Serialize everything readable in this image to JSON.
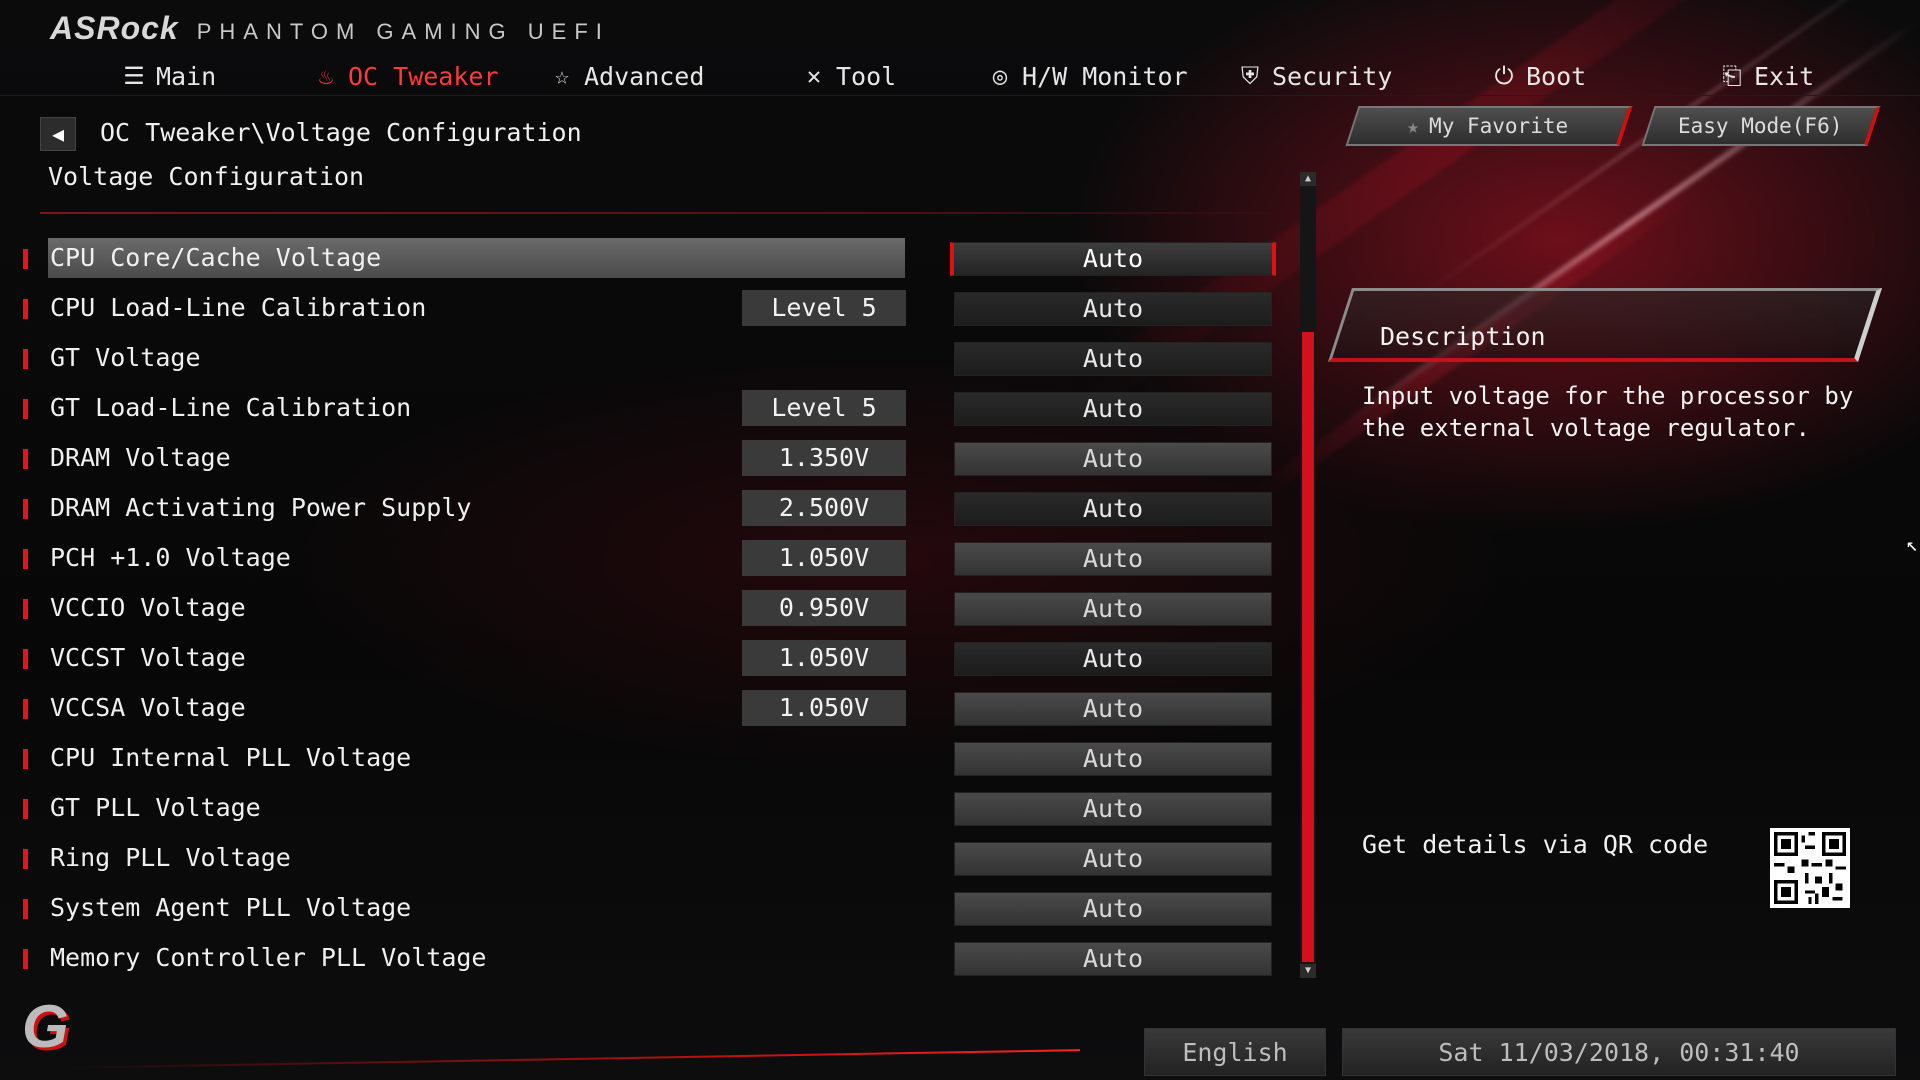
{
  "brand": {
    "logo": "ASRock",
    "subtitle": "PHANTOM GAMING UEFI"
  },
  "nav": [
    {
      "label": "Main",
      "icon": "list-icon",
      "glyph": "☰"
    },
    {
      "label": "OC Tweaker",
      "icon": "flame-icon",
      "glyph": "♨"
    },
    {
      "label": "Advanced",
      "icon": "star-icon",
      "glyph": "☆"
    },
    {
      "label": "Tool",
      "icon": "tools-icon",
      "glyph": "✕"
    },
    {
      "label": "H/W Monitor",
      "icon": "monitor-icon",
      "glyph": "◎"
    },
    {
      "label": "Security",
      "icon": "shield-icon",
      "glyph": "⛨"
    },
    {
      "label": "Boot",
      "icon": "power-icon",
      "glyph": "⏻"
    },
    {
      "label": "Exit",
      "icon": "exit-icon",
      "glyph": "⎗"
    }
  ],
  "active_tab": "OC Tweaker",
  "breadcrumb": "OC Tweaker\\Voltage Configuration",
  "page_title": "Voltage Configuration",
  "settings": [
    {
      "label": "CPU Core/Cache Voltage",
      "current": "",
      "value": "Auto",
      "selected": true
    },
    {
      "label": "CPU Load-Line Calibration",
      "current": "Level 5",
      "value": "Auto"
    },
    {
      "label": "GT Voltage",
      "current": "",
      "value": "Auto"
    },
    {
      "label": "GT Load-Line Calibration",
      "current": "Level 5",
      "value": "Auto"
    },
    {
      "label": "DRAM Voltage",
      "current": "1.350V",
      "value": "Auto"
    },
    {
      "label": "DRAM Activating Power Supply",
      "current": "2.500V",
      "value": "Auto"
    },
    {
      "label": "PCH +1.0 Voltage",
      "current": "1.050V",
      "value": "Auto"
    },
    {
      "label": "VCCIO Voltage",
      "current": "0.950V",
      "value": "Auto"
    },
    {
      "label": "VCCST Voltage",
      "current": "1.050V",
      "value": "Auto"
    },
    {
      "label": "VCCSA Voltage",
      "current": "1.050V",
      "value": "Auto"
    },
    {
      "label": "CPU Internal PLL Voltage",
      "current": "",
      "value": "Auto"
    },
    {
      "label": "GT PLL Voltage",
      "current": "",
      "value": "Auto"
    },
    {
      "label": "Ring PLL Voltage",
      "current": "",
      "value": "Auto"
    },
    {
      "label": "System Agent PLL Voltage",
      "current": "",
      "value": "Auto"
    },
    {
      "label": "Memory Controller PLL Voltage",
      "current": "",
      "value": "Auto"
    }
  ],
  "buttons": {
    "my_favorite": "My Favorite",
    "easy_mode": "Easy Mode(F6)"
  },
  "description": {
    "title": "Description",
    "text": "Input voltage for the processor by the external voltage regulator."
  },
  "qr": {
    "label": "Get details via QR code"
  },
  "footer": {
    "language": "English",
    "datetime": "Sat 11/03/2018, 00:31:40"
  },
  "colors": {
    "accent": "#e2141f",
    "active_tab": "#ff3a3a",
    "background": "#000000"
  }
}
